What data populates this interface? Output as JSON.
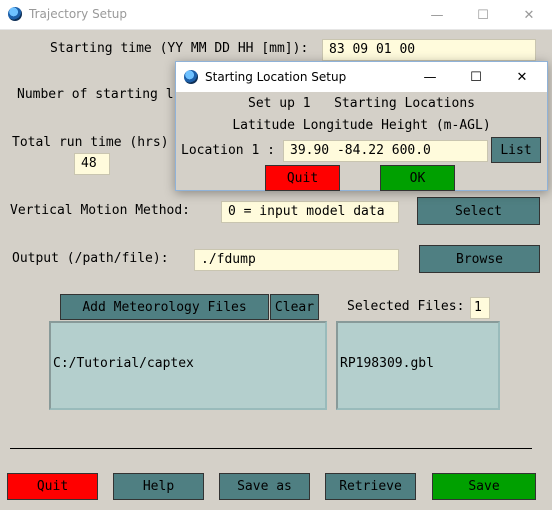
{
  "window": {
    "title": "Trajectory Setup",
    "minimize_glyph": "—",
    "maximize_glyph": "☐",
    "close_glyph": "✕"
  },
  "form": {
    "start_time_label": "Starting time (YY MM DD HH [mm]):",
    "start_time_value": "83 09 01 00",
    "num_locations_label": "Number of starting l",
    "run_time_label": "Total run time (hrs)",
    "run_time_value": "48",
    "vertical_motion_label": "Vertical Motion Method:",
    "vertical_motion_value": "0 = input model data",
    "select_button": "Select",
    "output_label": "Output (/path/file):",
    "output_value": "./fdump",
    "browse_button": "Browse"
  },
  "meteorology": {
    "add_button": "Add Meteorology Files",
    "clear_button": "Clear",
    "selected_files_label": "Selected Files:",
    "selected_files_count": "1",
    "directories": [
      "C:/Tutorial/captex"
    ],
    "files": [
      "RP198309.gbl"
    ]
  },
  "bottom_buttons": {
    "quit": "Quit",
    "help": "Help",
    "save_as": "Save as",
    "retrieve": "Retrieve",
    "save": "Save"
  },
  "dialog": {
    "title": "Starting Location Setup",
    "header_line1": "Set up 1   Starting Locations",
    "header_line2": "Latitude Longitude Height (m-AGL)",
    "location_label": "Location 1 :",
    "location_value": "39.90 -84.22 600.0",
    "list_button": "List",
    "quit_button": "Quit",
    "ok_button": "OK"
  },
  "colors": {
    "window_bg": "#d4d0c8",
    "field_bg": "#fffbdc",
    "teal_button": "#4f7f82",
    "quit_red": "#ff0000",
    "ok_green": "#00a000",
    "listbox_bg": "#b4cfcd"
  }
}
